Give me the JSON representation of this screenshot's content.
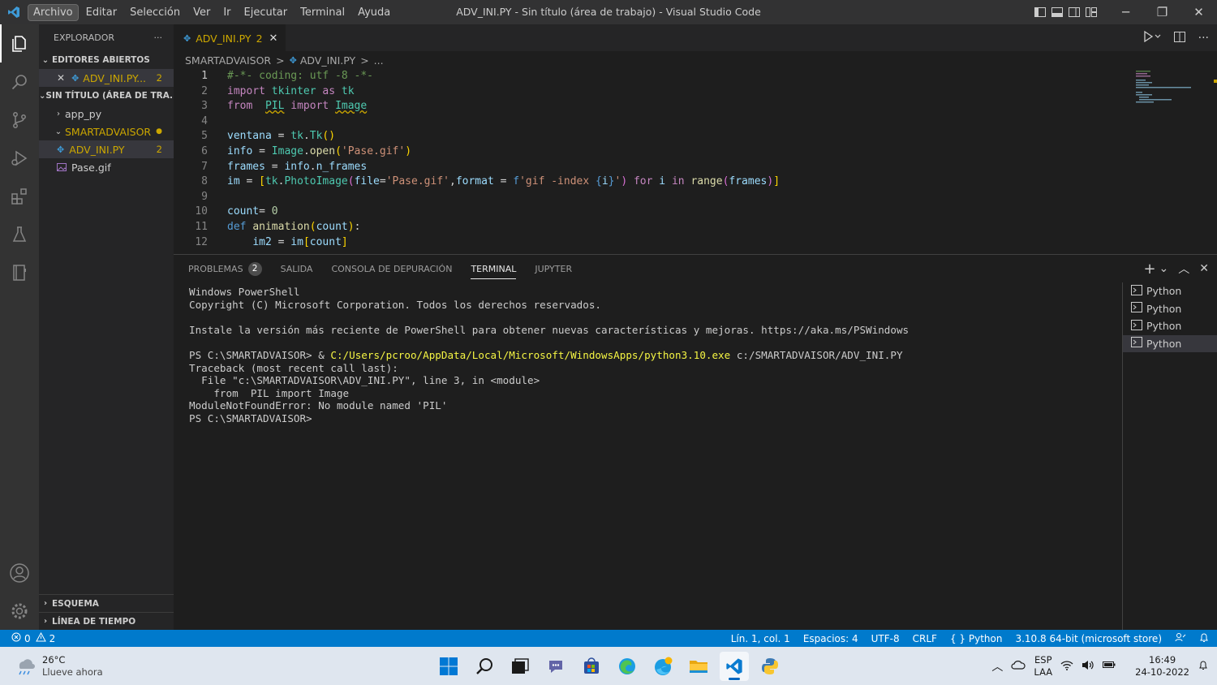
{
  "window": {
    "title": "ADV_INI.PY - Sin título (área de trabajo) - Visual Studio Code",
    "menu": [
      "Archivo",
      "Editar",
      "Selección",
      "Ver",
      "Ir",
      "Ejecutar",
      "Terminal",
      "Ayuda"
    ],
    "controls": {
      "minimize": "─",
      "restore": "❐",
      "close": "✕"
    }
  },
  "activity_bar": {
    "items": [
      "files-icon",
      "search-icon",
      "source-control-icon",
      "run-debug-icon",
      "extensions-icon",
      "testing-icon",
      "jupyter-icon"
    ],
    "bottom": [
      "account-icon",
      "settings-gear-icon"
    ]
  },
  "sidebar": {
    "header": "EXPLORADOR",
    "more": "···",
    "open_editors": {
      "title": "EDITORES ABIERTOS",
      "items": [
        {
          "close": "✕",
          "label": "ADV_INI.PY...",
          "badge": "2"
        }
      ]
    },
    "workspace": {
      "title": "SIN TÍTULO (ÁREA DE TRA...",
      "items": [
        {
          "label": "app_py"
        },
        {
          "label": "SMARTADVAISOR",
          "dot": "●"
        },
        {
          "label": "ADV_INI.PY",
          "badge": "2"
        },
        {
          "label": "Pase.gif"
        }
      ]
    },
    "outline": "ESQUEMA",
    "timeline": "LÍNEA DE TIEMPO"
  },
  "editor": {
    "tab": {
      "label": "ADV_INI.PY",
      "badge": "2",
      "close": "✕"
    },
    "breadcrumb": [
      "SMARTADVAISOR",
      ">",
      "ADV_INI.PY",
      ">",
      "..."
    ],
    "line_numbers": [
      "1",
      "2",
      "3",
      "4",
      "5",
      "6",
      "7",
      "8",
      "9",
      "10",
      "11",
      "12"
    ]
  },
  "panel": {
    "tabs": {
      "problems": "PROBLEMAS",
      "problems_count": "2",
      "output": "SALIDA",
      "debug_console": "CONSOLA DE DEPURACIÓN",
      "terminal": "TERMINAL",
      "jupyter": "JUPYTER"
    },
    "actions": {
      "add": "+",
      "chevron": "⌄",
      "maximize": "︿",
      "close": "✕"
    },
    "terminal_lines": {
      "l1": "Windows PowerShell",
      "l2": "Copyright (C) Microsoft Corporation. Todos los derechos reservados.",
      "l3": "Instale la versión más reciente de PowerShell para obtener nuevas características y mejoras. https://aka.ms/PSWindows",
      "l4_prompt": "PS C:\\SMARTADVAISOR> & ",
      "l4_exe": "C:/Users/pcroo/AppData/Local/Microsoft/WindowsApps/python3.10.exe",
      "l4_arg": " c:/SMARTADVAISOR/ADV_INI.PY",
      "l5": "Traceback (most recent call last):",
      "l6": "  File \"c:\\SMARTADVAISOR\\ADV_INI.PY\", line 3, in <module>",
      "l7": "    from  PIL import Image",
      "l8": "ModuleNotFoundError: No module named 'PIL'",
      "l9": "PS C:\\SMARTADVAISOR>"
    },
    "terminal_list": [
      "Python",
      "Python",
      "Python",
      "Python"
    ]
  },
  "status_bar": {
    "errors": "0",
    "warnings": "2",
    "position": "Lín. 1, col. 1",
    "spaces": "Espacios: 4",
    "encoding": "UTF-8",
    "eol": "CRLF",
    "language": "Python",
    "interpreter": "3.10.8 64-bit (microsoft store)"
  },
  "taskbar": {
    "weather_temp": "26°C",
    "weather_desc": "Llueve ahora",
    "apps": [
      "windows-start-icon",
      "search-icon",
      "task-view-icon",
      "teams-chat-icon",
      "store-icon",
      "edge-icon",
      "edge-beta-icon",
      "file-explorer-icon",
      "vscode-icon",
      "python-icon"
    ],
    "lang_1": "ESP",
    "lang_2": "LAA",
    "time": "16:49",
    "date": "24-10-2022"
  },
  "colors": {
    "accent": "#007acc",
    "warning": "#cca700",
    "background": "#1e1e1e"
  }
}
